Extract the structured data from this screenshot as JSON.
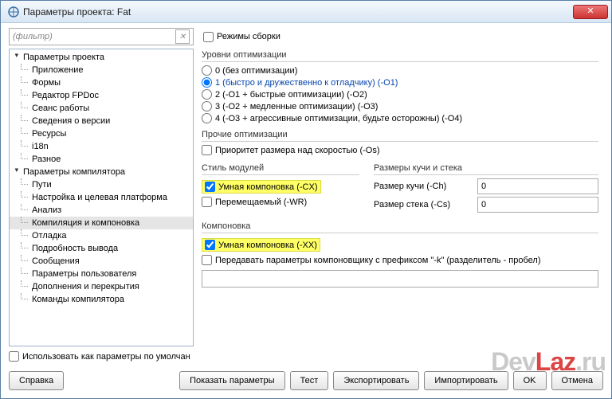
{
  "window": {
    "title": "Параметры проекта: Fat"
  },
  "filter": {
    "placeholder": "(фильтр)"
  },
  "build_modes": {
    "label": "Режимы сборки"
  },
  "tree": {
    "group1": {
      "title": "Параметры проекта",
      "items": [
        "Приложение",
        "Формы",
        "Редактор FPDoc",
        "Сеанс работы",
        "Сведения о версии",
        "Ресурсы",
        "i18n",
        "Разное"
      ]
    },
    "group2": {
      "title": "Параметры компилятора",
      "items": [
        "Пути",
        "Настройка и целевая платформа",
        "Анализ",
        "Компиляция и компоновка",
        "Отладка",
        "Подробность вывода",
        "Сообщения",
        "Параметры пользователя",
        "Дополнения и перекрытия",
        "Команды компилятора"
      ]
    }
  },
  "opt_levels": {
    "title": "Уровни оптимизации",
    "o0": "0 (без оптимизации)",
    "o1": "1 (быстро и дружественно к отладчику) (-O1)",
    "o2": "2 (-O1 + быстрые оптимизации) (-O2)",
    "o3": "3 (-O2 + медленные оптимизации) (-O3)",
    "o4": "4 (-O3 + агрессивные оптимизации, будьте осторожны) (-O4)"
  },
  "other_opt": {
    "title": "Прочие оптимизации",
    "size": "Приоритет размера над скоростью (-Os)"
  },
  "unit_style": {
    "title": "Стиль модулей",
    "smart": "Умная компоновка (-CX)",
    "reloc": "Перемещаемый (-WR)"
  },
  "heap": {
    "title": "Размеры кучи и стека",
    "heap_label": "Размер кучи (-Ch)",
    "stack_label": "Размер стека (-Cs)",
    "heap_val": "0",
    "stack_val": "0"
  },
  "linking": {
    "title": "Компоновка",
    "smart": "Умная компоновка (-XX)",
    "pass": "Передавать параметры компоновщику с префиксом \"-k\" (разделитель - пробел)"
  },
  "default_chk": "Использовать как параметры по умолчан",
  "buttons": {
    "help": "Справка",
    "show": "Показать параметры",
    "test": "Тест",
    "export": "Экспортировать",
    "import": "Импортировать",
    "ok": "OK",
    "cancel": "Отмена"
  },
  "watermark": {
    "a": "Dev",
    "b": "Laz",
    "c": ".ru"
  }
}
